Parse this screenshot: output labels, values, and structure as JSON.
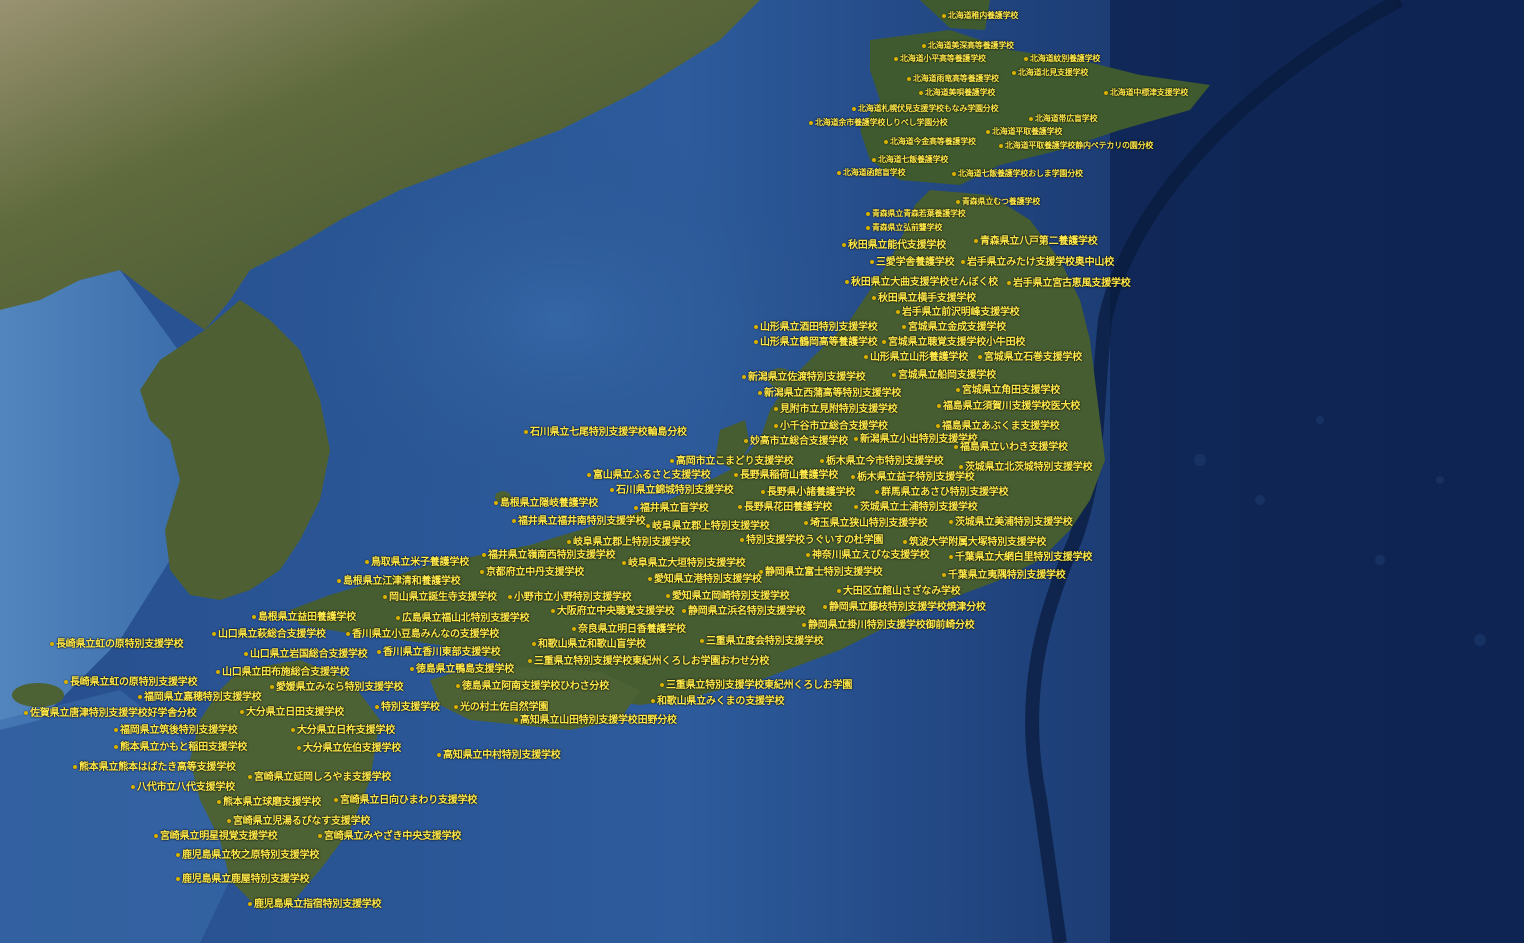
{
  "map": {
    "colors": {
      "label": "#ffe94a",
      "pin": "#d9b100",
      "deep_ocean": "#0d1f45",
      "shallow_ocean": "#3e6fb0",
      "land": "#4b5a36"
    },
    "labels": [
      "北海道稚内養護学校",
      "北海道美深高等養護学校",
      "北海道小平高等養護学校",
      "北海道紋別養護学校",
      "北海道雨竜高等養護学校",
      "北海道北見支援学校",
      "北海道美唄養護学校",
      "北海道中標津支援学校",
      "北海道札幌伏見支援学校もなみ学園分校",
      "北海道帯広盲学校",
      "北海道余市養護学校しりべし学園分校",
      "北海道平取養護学校",
      "北海道今金高等養護学校",
      "北海道平取養護学校静内ペテカリの園分校",
      "北海道七飯養護学校",
      "北海道函館盲学校",
      "北海道七飯養護学校おしま学園分校",
      "青森県立むつ養護学校",
      "青森県立青森若葉養護学校",
      "青森県立弘前聾学校",
      "秋田県立能代支援学校",
      "青森県立八戸第二養護学校",
      "三愛学舎養護学校",
      "岩手県立みたけ支援学校奥中山校",
      "秋田県立大曲支援学校せんぼく校",
      "岩手県立宮古恵風支援学校",
      "秋田県立横手支援学校",
      "岩手県立前沢明峰支援学校",
      "山形県立酒田特別支援学校",
      "宮城県立金成支援学校",
      "山形県立鶴岡高等養護学校",
      "宮城県立聴覚支援学校小牛田校",
      "山形県立山形養護学校",
      "宮城県立石巻支援学校",
      "新潟県立佐渡特別支援学校",
      "宮城県立船岡支援学校",
      "新潟県立西蒲高等特別支援学校",
      "宮城県立角田支援学校",
      "見附市立見附特別支援学校",
      "福島県立須賀川支援学校医大校",
      "石川県立七尾特別支援学校輪島分校",
      "小千谷市立総合支援学校",
      "福島県立あぶくま支援学校",
      "妙高市立総合支援学校",
      "新潟県立小出特別支援学校",
      "福島県立いわき支援学校",
      "高岡市立こまどり支援学校",
      "栃木県立今市特別支援学校",
      "茨城県立北茨城特別支援学校",
      "富山県立ふるさと支援学校",
      "長野県稲荷山養護学校",
      "栃木県立益子特別支援学校",
      "石川県立錦城特別支援学校",
      "長野県小諸養護学校",
      "群馬県立あさひ特別支援学校",
      "島根県立隠岐養護学校",
      "福井県立盲学校",
      "長野県花田養護学校",
      "茨城県立土浦特別支援学校",
      "福井県立福井南特別支援学校",
      "岐阜県立郡上特別支援学校",
      "埼玉県立狭山特別支援学校",
      "茨城県立美浦特別支援学校",
      "岐阜県立郡上特別支援学校",
      "特別支援学校うぐいすの杜学園",
      "筑波大学附属大塚特別支援学校",
      "福井県立嶺南西特別支援学校",
      "神奈川県立えびな支援学校",
      "千葉県立大網白里特別支援学校",
      "鳥取県立米子養護学校",
      "京都府立中丹支援学校",
      "岐阜県立大垣特別支援学校",
      "静岡県立富士特別支援学校",
      "千葉県立夷隅特別支援学校",
      "島根県立江津清和養護学校",
      "愛知県立港特別支援学校",
      "大田区立館山さざなみ学校",
      "岡山県立誕生寺支援学校",
      "小野市立小野特別支援学校",
      "愛知県立岡崎特別支援学校",
      "島根県立益田養護学校",
      "広島県立福山北特別支援学校",
      "大阪府立中央聴覚支援学校",
      "静岡県立浜名特別支援学校",
      "静岡県立藤枝特別支援学校焼津分校",
      "山口県立萩総合支援学校",
      "香川県立小豆島みんなの支援学校",
      "奈良県立明日香養護学校",
      "静岡県立掛川特別支援学校御前崎分校",
      "長崎県立虹の原特別支援学校",
      "和歌山県立和歌山盲学校",
      "三重県立度会特別支援学校",
      "山口県立岩国総合支援学校",
      "香川県立香川東部支援学校",
      "三重県立特別支援学校東紀州くろしお学園おわせ分校",
      "徳島県立鴨島支援学校",
      "山口県立田布施総合支援学校",
      "長崎県立虹の原特別支援学校",
      "愛媛県立みなら特別支援学校",
      "徳島県立阿南支援学校ひわさ分校",
      "三重県立特別支援学校東紀州くろしお学園",
      "福岡県立嘉穂特別支援学校",
      "和歌山県立みくまの支援学校",
      "佐賀県立唐津特別支援学校好学舎分校",
      "大分県立日田支援学校",
      "特別支援学校",
      "光の村土佐自然学園",
      "高知県立山田特別支援学校田野分校",
      "福岡県立筑後特別支援学校",
      "大分県立日杵支援学校",
      "熊本県立かもと稲田支援学校",
      "大分県立佐伯支援学校",
      "高知県立中村特別支援学校",
      "熊本県立熊本はばたき高等支援学校",
      "宮崎県立延岡しろやま支援学校",
      "八代市立八代支援学校",
      "熊本県立球磨支援学校",
      "宮崎県立日向ひまわり支援学校",
      "宮崎県立児湯るぴなす支援学校",
      "宮崎県立明星視覚支援学校",
      "宮崎県立みやざき中央支援学校",
      "鹿児島県立牧之原特別支援学校",
      "鹿児島県立鹿屋特別支援学校",
      "鹿児島県立指宿特別支援学校"
    ]
  }
}
